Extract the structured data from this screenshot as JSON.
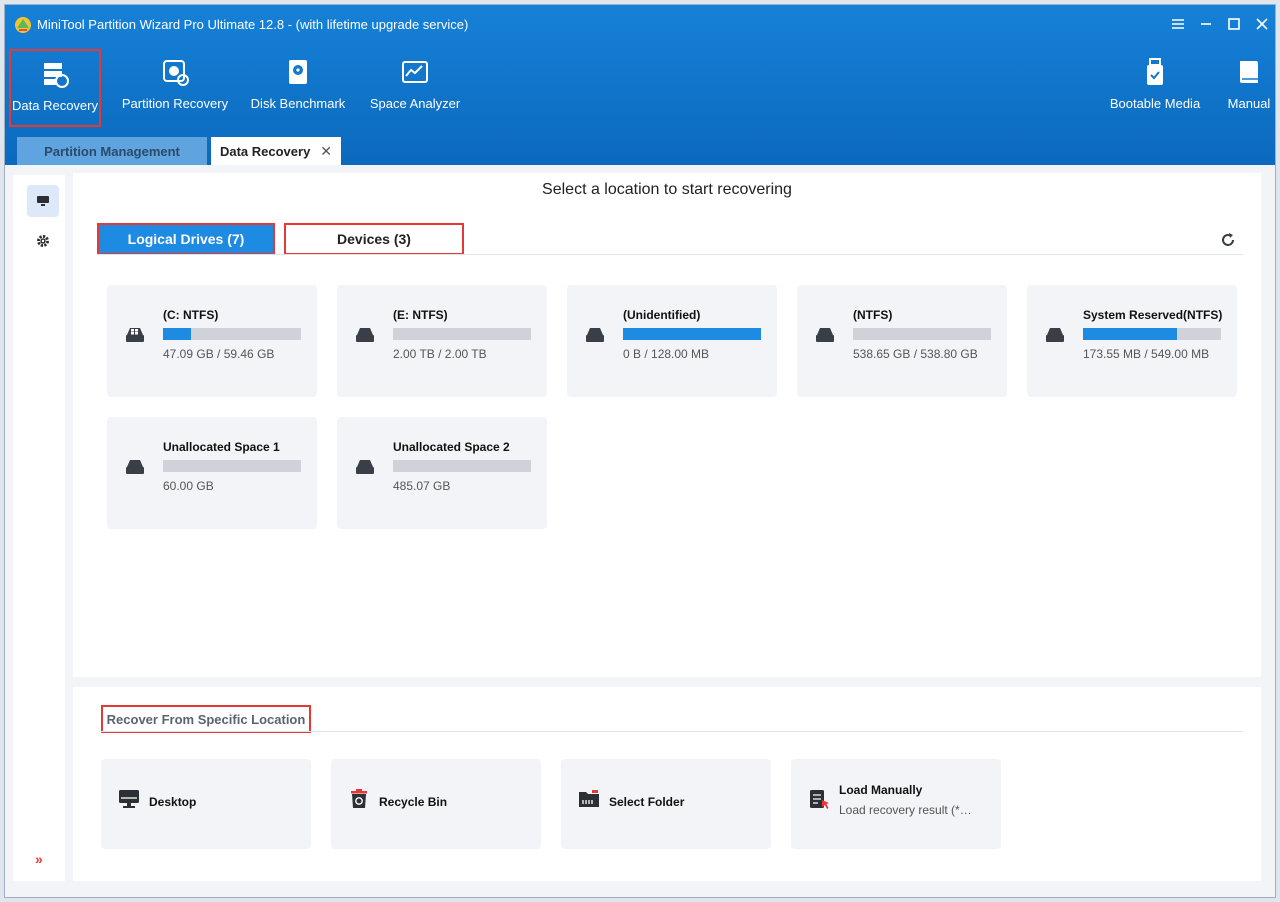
{
  "window": {
    "title": "MiniTool Partition Wizard Pro Ultimate 12.8 - (with lifetime upgrade service)"
  },
  "toolbar": {
    "items": [
      {
        "label": "Data Recovery",
        "icon": "data-recovery-icon"
      },
      {
        "label": "Partition Recovery",
        "icon": "partition-recovery-icon"
      },
      {
        "label": "Disk Benchmark",
        "icon": "disk-benchmark-icon"
      },
      {
        "label": "Space Analyzer",
        "icon": "space-analyzer-icon"
      },
      {
        "label": "Bootable Media",
        "icon": "bootable-media-icon"
      },
      {
        "label": "Manual",
        "icon": "manual-icon"
      }
    ]
  },
  "tabs": [
    {
      "label": "Partition Management"
    },
    {
      "label": "Data Recovery",
      "close": "✕"
    }
  ],
  "main": {
    "title": "Select a location to start recovering",
    "subtabs": [
      {
        "label": "Logical Drives (7)"
      },
      {
        "label": "Devices (3)"
      }
    ],
    "drives": [
      {
        "name": "(C: NTFS)",
        "size": "47.09 GB / 59.46 GB",
        "used_fraction": 0.2,
        "icon": "windows-drive-icon"
      },
      {
        "name": "(E: NTFS)",
        "size": "2.00 TB / 2.00 TB",
        "used_fraction": 0.0,
        "icon": "drive-icon"
      },
      {
        "name": "(Unidentified)",
        "size": "0 B / 128.00 MB",
        "used_fraction": 1.0,
        "icon": "drive-icon"
      },
      {
        "name": "(NTFS)",
        "size": "538.65 GB / 538.80 GB",
        "used_fraction": 0.0,
        "icon": "drive-icon"
      },
      {
        "name": "System Reserved(NTFS)",
        "size": "173.55 MB / 549.00 MB",
        "used_fraction": 0.68,
        "icon": "drive-icon"
      },
      {
        "name": "Unallocated Space 1",
        "size": "60.00 GB",
        "used_fraction": 0.0,
        "icon": "drive-icon"
      },
      {
        "name": "Unallocated Space 2",
        "size": "485.07 GB",
        "used_fraction": 0.0,
        "icon": "drive-icon"
      }
    ]
  },
  "bottom": {
    "title": "Recover From Specific Location",
    "locations": [
      {
        "label": "Desktop",
        "icon": "desktop-icon"
      },
      {
        "label": "Recycle Bin",
        "icon": "recycle-bin-icon"
      },
      {
        "label": "Select Folder",
        "icon": "folder-icon"
      },
      {
        "label": "Load Manually",
        "sub": "Load recovery result (*…",
        "icon": "load-manually-icon"
      }
    ]
  },
  "sidebar": {
    "expand": "»"
  },
  "colors": {
    "header": "#1681d8",
    "accent": "#1e8be3",
    "highlight": "#e53935"
  }
}
